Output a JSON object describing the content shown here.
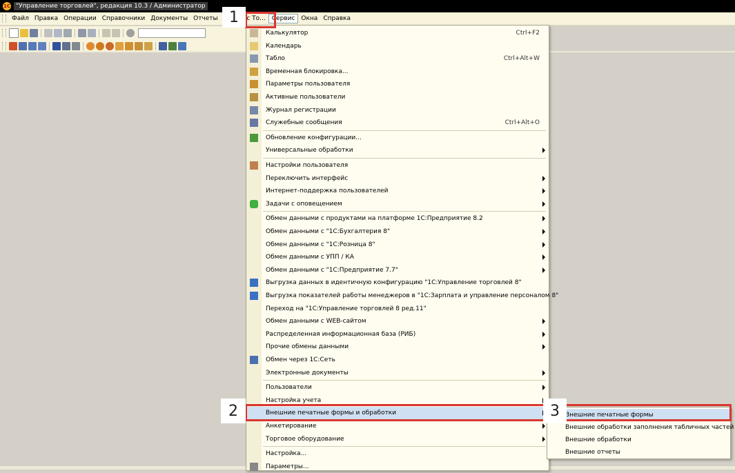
{
  "window": {
    "title": "\"Управление торговлей\", редакция 10.3 / Администратор",
    "app_icon_text": "1С"
  },
  "menubar": [
    {
      "label": "Файл",
      "accel": "Ф"
    },
    {
      "label": "Правка"
    },
    {
      "label": "Операции"
    },
    {
      "label": "Справочники"
    },
    {
      "label": "Документы"
    },
    {
      "label": "Отчеты"
    },
    {
      "label": "Обмен с То..."
    },
    {
      "label": "Сервис",
      "active": true
    },
    {
      "label": "Окна"
    },
    {
      "label": "Справка"
    }
  ],
  "menu": {
    "items": [
      {
        "label": "Калькулятор",
        "shortcut": "Ctrl+F2",
        "icon": "calculator-icon"
      },
      {
        "label": "Календарь",
        "icon": "calendar-icon"
      },
      {
        "label": "Табло",
        "shortcut": "Ctrl+Alt+W",
        "icon": "board-icon"
      },
      {
        "label": "Временная блокировка...",
        "icon": "users-lock-icon"
      },
      {
        "label": "Параметры пользователя",
        "icon": "user-settings-icon"
      },
      {
        "label": "Активные пользователи",
        "icon": "active-users-icon"
      },
      {
        "label": "Журнал регистрации",
        "icon": "log-icon"
      },
      {
        "label": "Служебные сообщения",
        "shortcut": "Ctrl+Alt+O",
        "icon": "messages-icon"
      },
      {
        "label": "Обновление конфигурации...",
        "icon": "update-icon"
      },
      {
        "label": "Универсальные обработки",
        "submenu": true
      },
      {
        "label": "Настройки пользователя",
        "icon": "user-prefs-icon"
      },
      {
        "label": "Переключить интерфейс",
        "submenu": true
      },
      {
        "label": "Интернет-поддержка пользователей",
        "submenu": true
      },
      {
        "label": "Задачи с оповещением",
        "submenu": true,
        "icon": "tasks-icon"
      },
      {
        "label": "Обмен данными с продуктами на платформе 1С:Предприятие 8.2",
        "submenu": true
      },
      {
        "label": "Обмен данными с \"1С:Бухгалтерия 8\"",
        "submenu": true
      },
      {
        "label": "Обмен данными с \"1С:Розница 8\"",
        "submenu": true
      },
      {
        "label": "Обмен данными с УПП / КА",
        "submenu": true
      },
      {
        "label": "Обмен данными с \"1С:Предприятие 7.7\"",
        "submenu": true
      },
      {
        "label": "Выгрузка данных в идентичную конфигурацию \"1С:Управление торговлей 8\"",
        "icon": "export-icon"
      },
      {
        "label": "Выгрузка показателей работы менеджеров в \"1С:Зарплата и управление персоналом 8\"",
        "icon": "export-managers-icon"
      },
      {
        "label": "Переход на \"1С:Управление торговлей 8 ред.11\""
      },
      {
        "label": "Обмен данными с WEB-сайтом",
        "submenu": true
      },
      {
        "label": "Распределенная информационная база (РИБ)",
        "submenu": true
      },
      {
        "label": "Прочие обмены данными",
        "submenu": true
      },
      {
        "label": "Обмен через 1С:Сеть",
        "icon": "network-icon"
      },
      {
        "label": "Электронные документы",
        "submenu": true
      },
      {
        "label": "Пользователи",
        "submenu": true
      },
      {
        "label": "Настройка учета",
        "submenu": true
      },
      {
        "label": "Внешние печатные формы и обработки",
        "submenu": true,
        "highlighted": true
      },
      {
        "label": "Анкетирование",
        "submenu": true
      },
      {
        "label": "Торговое оборудование",
        "submenu": true
      },
      {
        "label": "Настройка..."
      },
      {
        "label": "Параметры...",
        "icon": "parameters-icon"
      }
    ]
  },
  "submenu": {
    "items": [
      {
        "label": "Внешние печатные формы",
        "highlighted": true
      },
      {
        "label": "Внешние обработки заполнения табличных частей"
      },
      {
        "label": "Внешние обработки"
      },
      {
        "label": "Внешние отчеты"
      }
    ]
  },
  "callouts": {
    "step1": "1",
    "step2": "2",
    "step3": "3"
  },
  "colors": {
    "annotation_red": "#d9362f",
    "highlight": "#cfe0f2",
    "menu_bg": "#fffdf0"
  }
}
